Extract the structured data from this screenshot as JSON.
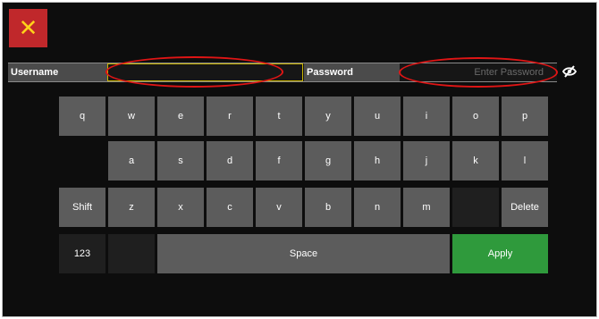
{
  "close": {
    "glyph": "✕",
    "icon": "close-icon"
  },
  "fields": {
    "username_label": "Username",
    "username_value": "",
    "password_label": "Password",
    "password_placeholder": "Enter Password",
    "visibility_icon": "eye-off-icon"
  },
  "keyboard": {
    "row1": [
      "q",
      "w",
      "e",
      "r",
      "t",
      "y",
      "u",
      "i",
      "o",
      "p"
    ],
    "row2": [
      "a",
      "s",
      "d",
      "f",
      "g",
      "h",
      "j",
      "k",
      "l"
    ],
    "row3": [
      "Shift",
      "z",
      "x",
      "c",
      "v",
      "b",
      "n",
      "m",
      "",
      "Delete"
    ],
    "row4": [
      "123",
      "",
      "Space",
      "Apply"
    ]
  },
  "colors": {
    "close_bg": "#c0282b",
    "close_x": "#ffd21a",
    "key": "#5c5c5c",
    "apply": "#2f9a3c",
    "annotation": "#e01515"
  }
}
